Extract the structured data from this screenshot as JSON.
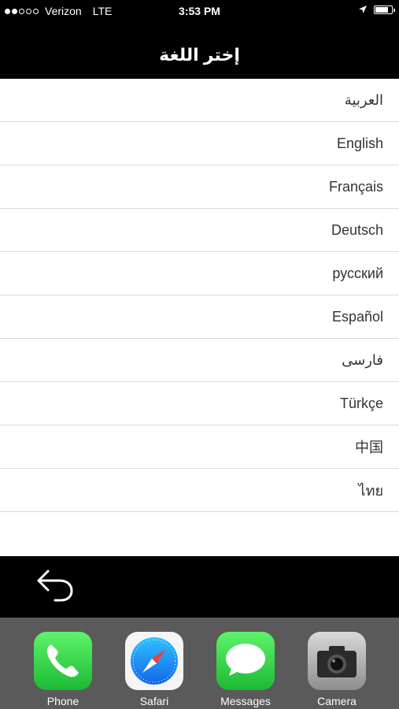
{
  "status_bar": {
    "carrier": "Verizon",
    "network": "LTE",
    "time": "3:53 PM",
    "signal_strength": 2,
    "signal_max": 5
  },
  "header": {
    "title": "إختر اللغة"
  },
  "languages": [
    "العربية",
    "English",
    "Français",
    "Deutsch",
    "русский",
    "Español",
    "فارسی",
    "Türkçe",
    "中国",
    "ไทย"
  ],
  "dock": {
    "apps": [
      {
        "label": "Phone",
        "icon": "phone-icon",
        "color": "#2fd34d"
      },
      {
        "label": "Safari",
        "icon": "safari-icon",
        "color": "#1a8cff"
      },
      {
        "label": "Messages",
        "icon": "messages-icon",
        "color": "#2fd34d"
      },
      {
        "label": "Camera",
        "icon": "camera-icon",
        "color": "#9b9b9b"
      }
    ]
  }
}
